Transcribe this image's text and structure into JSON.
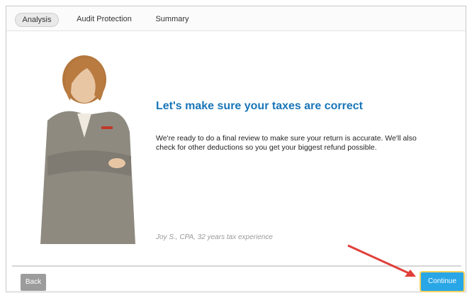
{
  "tabs": [
    {
      "label": "Analysis",
      "active": true
    },
    {
      "label": "Audit Protection",
      "active": false
    },
    {
      "label": "Summary",
      "active": false
    }
  ],
  "main": {
    "headline": "Let's make sure your taxes are correct",
    "body": "We're ready to do a final review to make sure your return is accurate. We'll also check for other deductions so you get your biggest refund possible.",
    "quote": "Joy S., CPA, 32 years tax experience"
  },
  "footer": {
    "back_label": "Back",
    "continue_label": "Continue"
  },
  "colors": {
    "headline": "#1a76b8",
    "continue_button": "#29a6e6",
    "arrow": "#e0403a",
    "highlight": "#f4d35e"
  }
}
